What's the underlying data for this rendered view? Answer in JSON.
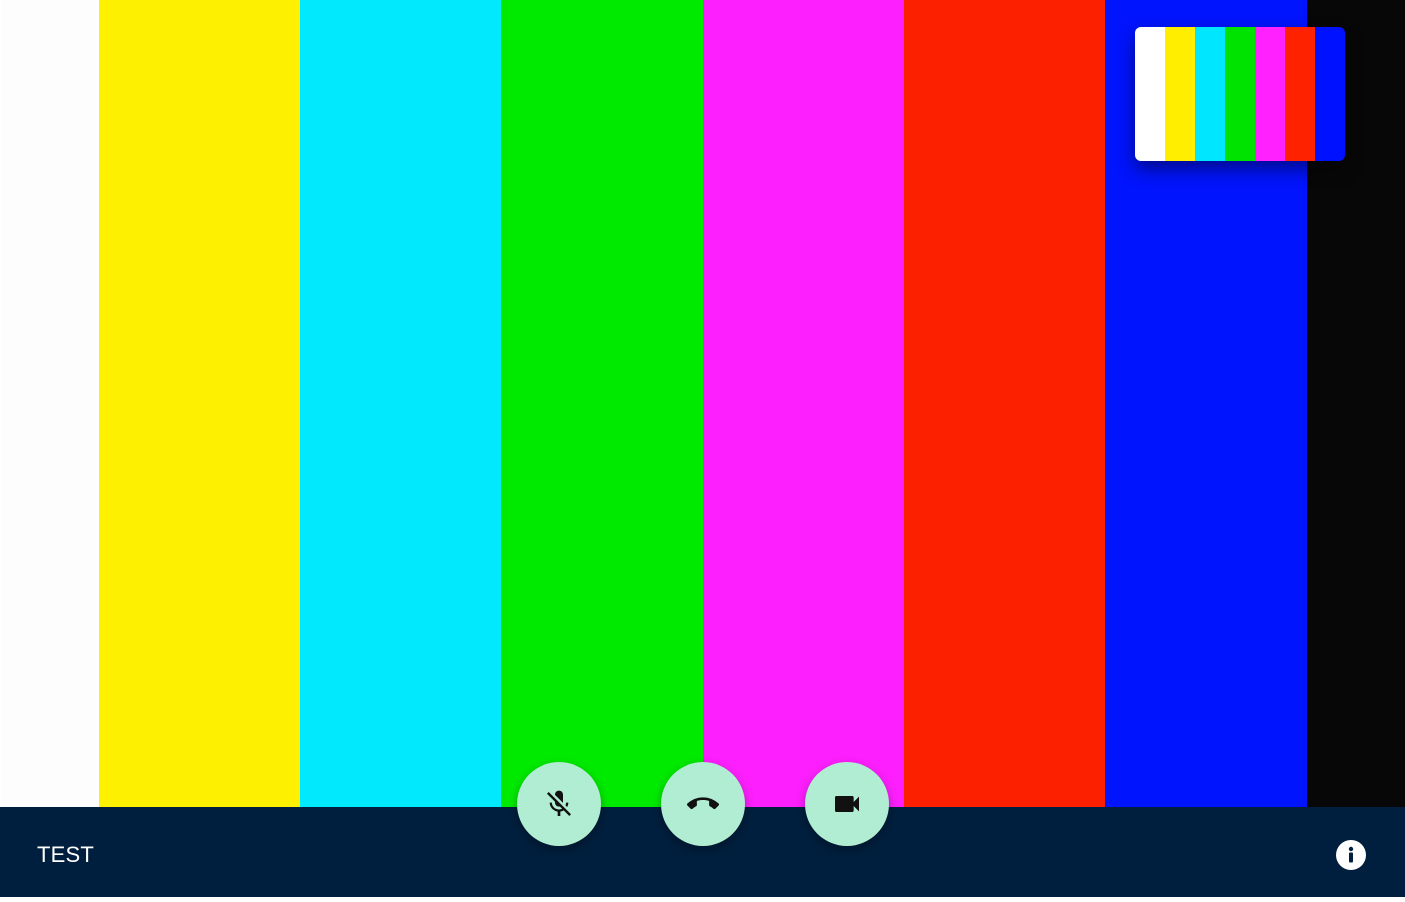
{
  "video": {
    "test_pattern_colors": [
      "#fdfdfd",
      "#fdf000",
      "#00e9fd",
      "#00ea00",
      "#fd1ffd",
      "#fd2000",
      "#0014fd",
      "#070707"
    ],
    "preview_colors": [
      "#ffffff",
      "#ffee00",
      "#00e6ff",
      "#00e300",
      "#ff22ff",
      "#ff2200",
      "#0011ff"
    ]
  },
  "controls": {
    "mute_icon": "mic-off-icon",
    "hangup_icon": "call-end-icon",
    "camera_icon": "videocam-icon",
    "button_color": "#b1edd3",
    "icon_color": "#111111"
  },
  "footer": {
    "room_name": "TEST",
    "info_icon": "info-icon",
    "background": "#001f3e"
  }
}
